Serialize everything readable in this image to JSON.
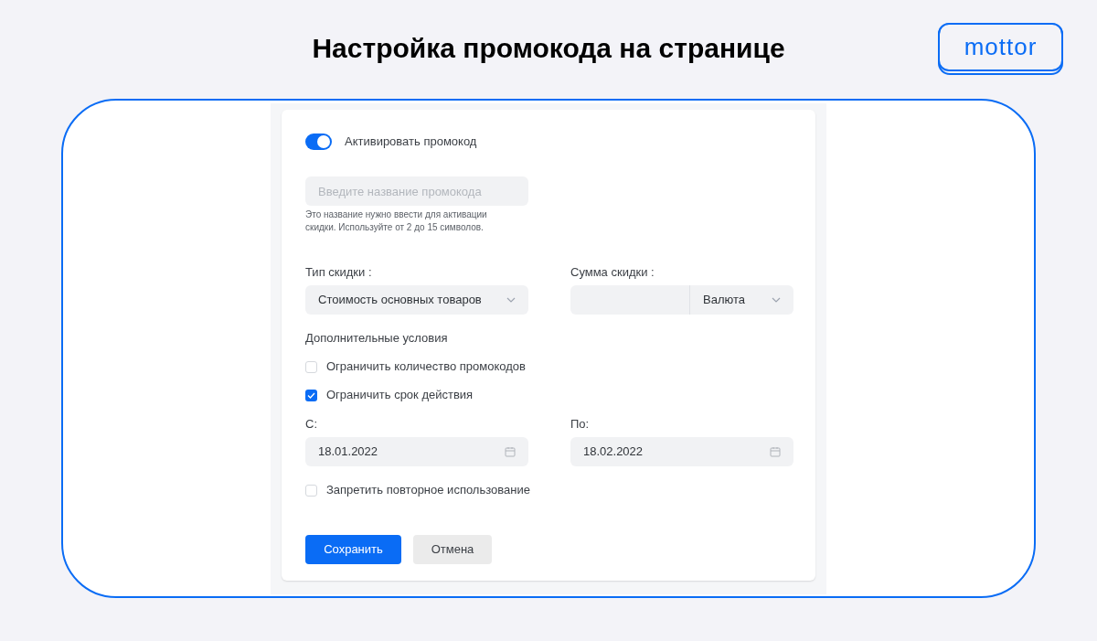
{
  "page": {
    "title": "Настройка промокода на странице",
    "logo": "mottor"
  },
  "form": {
    "toggle": {
      "label": "Активировать промокод",
      "on": true
    },
    "promo_field": {
      "placeholder": "Введите название промокода",
      "hint": "Это название нужно ввести для активации скидки. Используйте от 2 до 15 символов."
    },
    "discount_type": {
      "label": "Тип скидки :",
      "value": "Стоимость основных товаров"
    },
    "discount_amount": {
      "label": "Сумма скидки :",
      "currency": "Валюта"
    },
    "conditions_title": "Дополнительные условия",
    "conditions": [
      {
        "label": "Ограничить количество промокодов",
        "checked": false
      },
      {
        "label": "Ограничить срок действия",
        "checked": true
      }
    ],
    "dates": [
      {
        "label": "С:",
        "value": "18.01.2022"
      },
      {
        "label": "По:",
        "value": "18.02.2022"
      }
    ],
    "extra_conditions": [
      {
        "label": "Запретить повторное использование",
        "checked": false
      }
    ],
    "buttons": [
      {
        "label": "Сохранить",
        "kind": "primary"
      },
      {
        "label": "Отмена",
        "kind": "secondary"
      }
    ]
  }
}
